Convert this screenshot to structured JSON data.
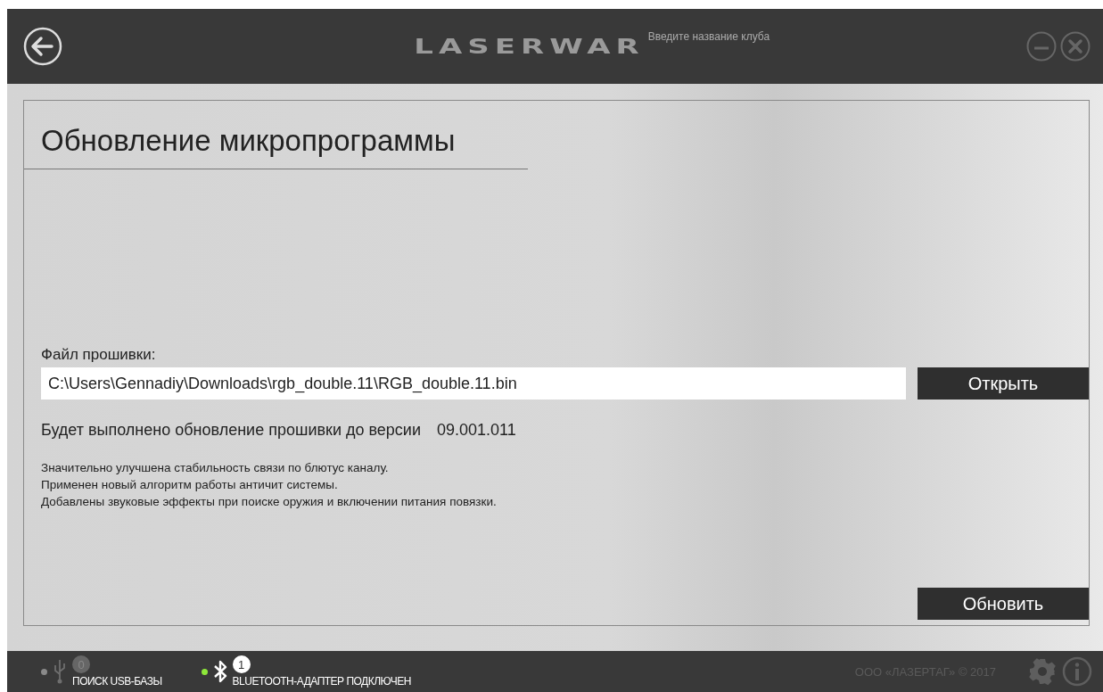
{
  "header": {
    "logo": "LASERWAR",
    "club_placeholder": "Введите название клуба"
  },
  "page": {
    "title": "Обновление микропрограммы",
    "file_label": "Файл прошивки:",
    "file_path": "C:\\Users\\Gennadiy\\Downloads\\rgb_double.11\\RGB_double.11.bin",
    "open_button": "Открыть",
    "version_text": "Будет выполнено обновление прошивки до версии",
    "version": "09.001.011",
    "notes": [
      "Значительно улучшена стабильность связи по блютус каналу.",
      "Применен новый алгоритм работы античит системы.",
      "Добавлены звуковые эффекты при поиске оружия и включении питания повязки."
    ],
    "update_button": "Обновить"
  },
  "status_bar": {
    "devices": [
      {
        "kind": "usb",
        "count": "0",
        "label": "ПОИСК USB-БАЗЫ",
        "connected": false
      },
      {
        "kind": "bluetooth",
        "count": "1",
        "label": "BLUETOOTH-АДАПТЕР ПОДКЛЮЧЕН",
        "connected": true
      }
    ],
    "copyright": "ООО «ЛАЗЕРТАГ» © 2017"
  }
}
